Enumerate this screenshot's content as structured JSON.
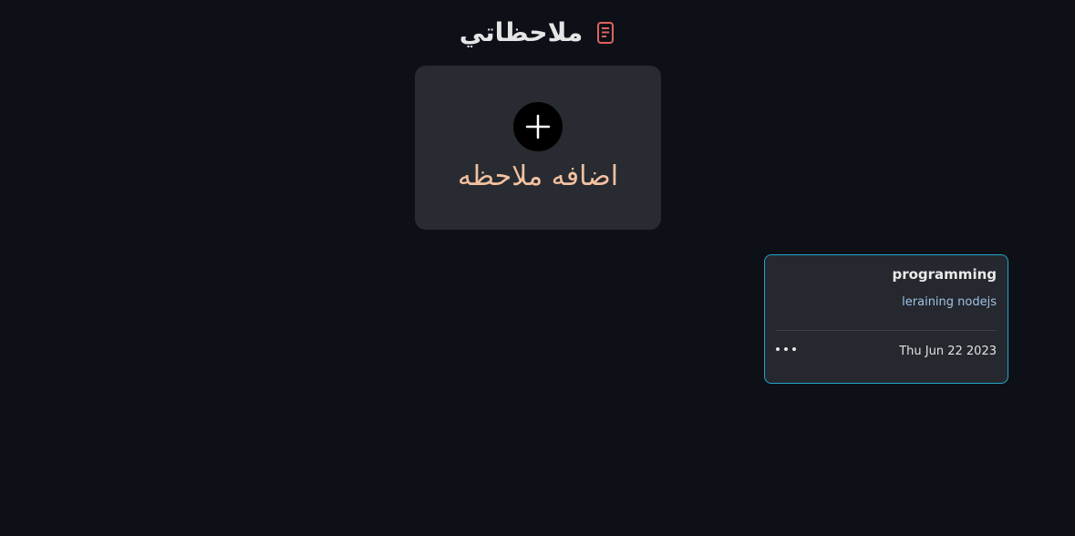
{
  "header": {
    "title": "ملاحظاتي",
    "icon": "note-icon",
    "icon_color": "#e0625d"
  },
  "add_card": {
    "label": "اضافه ملاحظه",
    "icon": "plus-icon",
    "label_color": "#f2c1a0"
  },
  "notes": [
    {
      "title": "programming",
      "description": "leraining nodejs",
      "date": "Thu Jun 22 2023",
      "menu_icon": "more-icon",
      "border_color": "#1fa7c9"
    }
  ]
}
